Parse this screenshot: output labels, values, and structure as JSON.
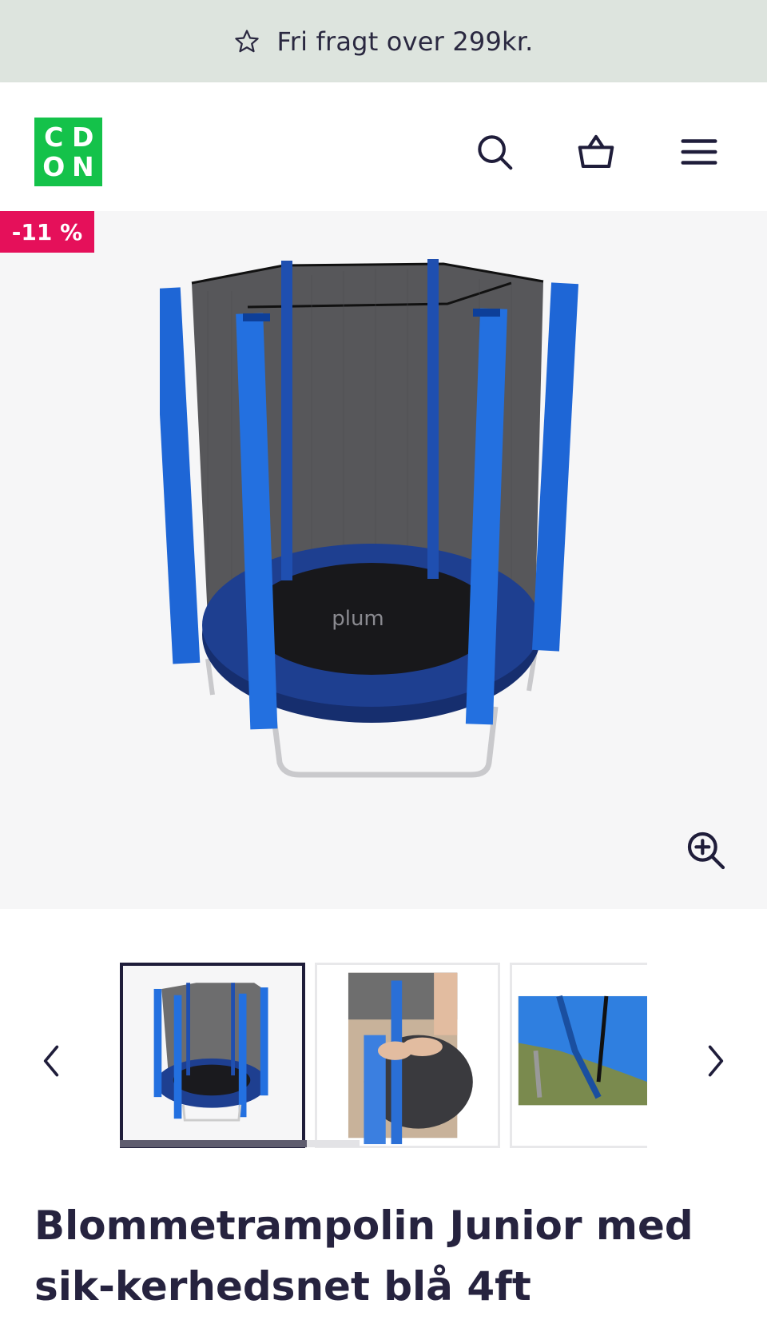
{
  "promo": {
    "text": "Fri fragt over 299kr.",
    "icon": "star-outline-icon"
  },
  "header": {
    "logo_letters": [
      "C",
      "D",
      "O",
      "N"
    ],
    "logo_color": "#14c24a",
    "icons": [
      "search-icon",
      "basket-icon",
      "hamburger-menu-icon"
    ]
  },
  "gallery": {
    "discount_badge": "-11 %",
    "badge_color": "#e5105a",
    "main_image": "trampoline-with-safety-net",
    "zoom_icon": "zoom-in-icon"
  },
  "thumbnails": {
    "items": [
      "trampoline-full-view",
      "person-closing-net-zipper",
      "net-zipper-closeup"
    ],
    "active_index": 0,
    "prev_icon": "chevron-left-icon",
    "next_icon": "chevron-right-icon"
  },
  "product": {
    "title": "Blommetrampolin Junior med sik-kerhedsnet blå 4ft"
  }
}
